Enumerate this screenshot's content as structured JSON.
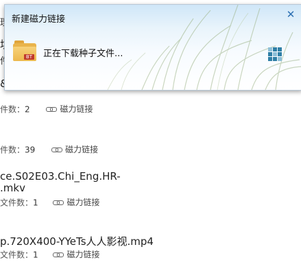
{
  "dialog": {
    "title": "新建磁力链接",
    "status": "正在下载种子文件...",
    "folder_badge": "BT",
    "close_icon": "close-icon",
    "spinner_icon": "loading-grid-icon"
  },
  "results": {
    "fragments": {
      "left1": "理",
      "left2": "坑",
      "left3": "件",
      "left4": "&"
    },
    "items": [
      {
        "name_line1": "",
        "name_line2": "",
        "count_label": "件数：",
        "count": "2",
        "magnet_label": "磁力链接"
      },
      {
        "name_line1": "",
        "name_line2": "",
        "count_label": "件数：",
        "count": "39",
        "magnet_label": "磁力链接"
      },
      {
        "name_line1": "ce.S02E03.Chi_Eng.HR-",
        "name_line2": ".mkv",
        "count_label": "文件数：",
        "count": "1",
        "magnet_label": "磁力链接"
      },
      {
        "name_line1": "p.720X400-YYeTs人人影视.mp4",
        "name_line2": "",
        "count_label": "文件数：",
        "count": "1",
        "magnet_label": "磁力链接"
      }
    ]
  }
}
